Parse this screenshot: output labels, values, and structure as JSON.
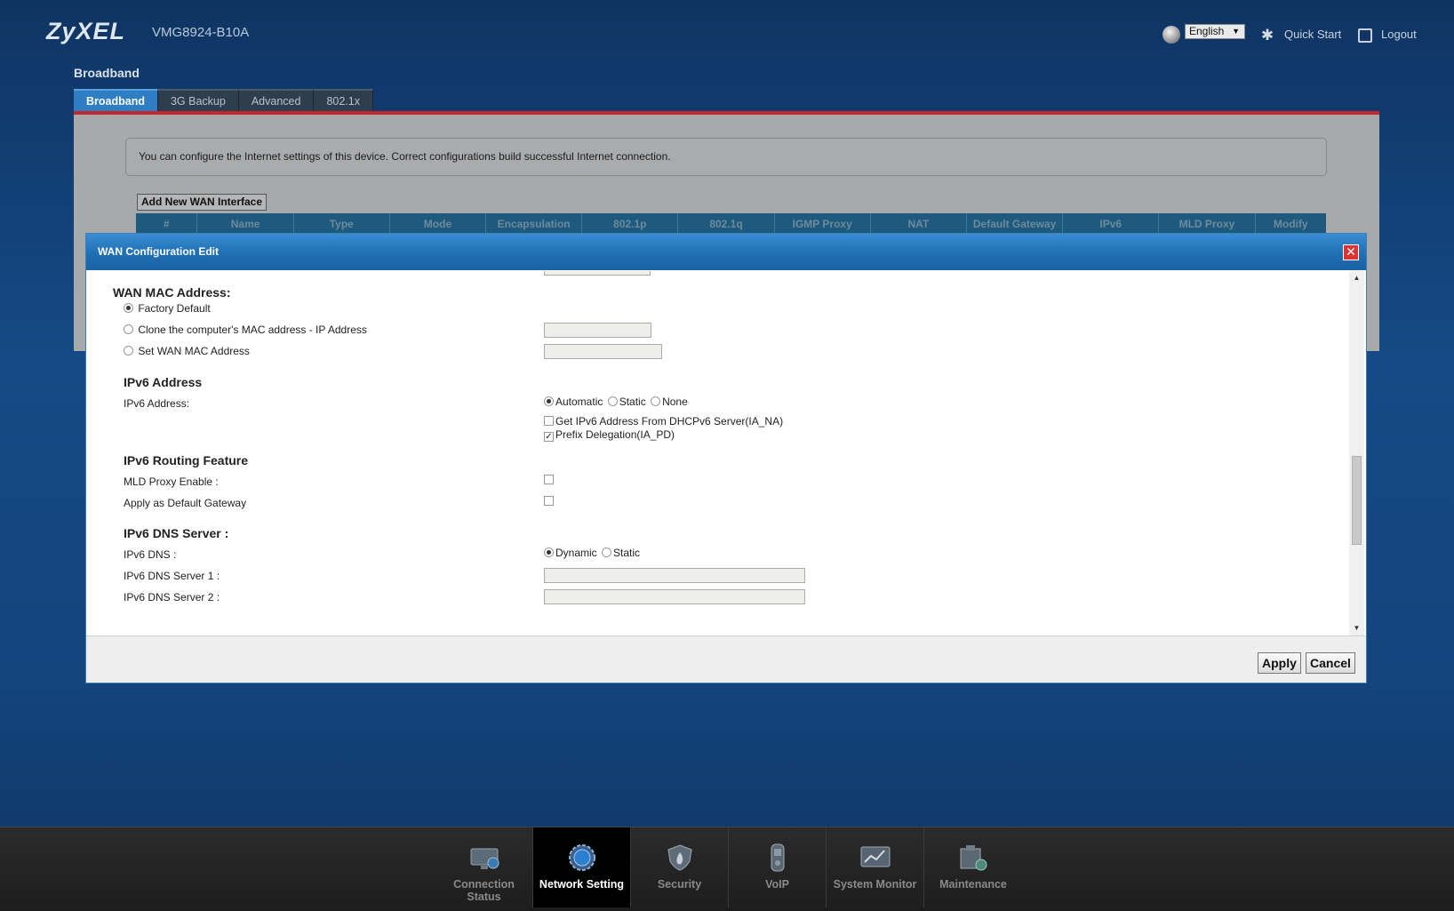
{
  "header": {
    "brand": "ZyXEL",
    "model": "VMG8924-B10A",
    "language": "English",
    "quick_start": "Quick Start",
    "logout": "Logout"
  },
  "page": {
    "title": "Broadband",
    "tabs": [
      {
        "label": "Broadband",
        "active": true
      },
      {
        "label": "3G Backup",
        "active": false
      },
      {
        "label": "Advanced",
        "active": false
      },
      {
        "label": "802.1x",
        "active": false
      }
    ],
    "info": "You can configure the Internet settings of this device. Correct configurations build successful Internet connection.",
    "add_wan": "Add New WAN Interface",
    "columns": [
      "#",
      "Name",
      "Type",
      "Mode",
      "Encapsulation",
      "802.1p",
      "802.1q",
      "IGMP Proxy",
      "NAT",
      "Default Gateway",
      "IPv6",
      "MLD Proxy",
      "Modify"
    ]
  },
  "modal": {
    "title": "WAN Configuration Edit",
    "close": "✕",
    "wan_mac": {
      "heading": "WAN MAC Address:",
      "factory_default": "Factory Default",
      "clone": "Clone the computer's MAC address - IP Address",
      "set": "Set WAN MAC Address"
    },
    "ipv6_address": {
      "heading": "IPv6 Address",
      "label": "IPv6 Address:",
      "automatic": "Automatic",
      "static": "Static",
      "none": "None",
      "get_dhcpv6": "Get IPv6 Address From DHCPv6 Server(IA_NA)",
      "prefix_delegation": "Prefix Delegation(IA_PD)"
    },
    "ipv6_routing": {
      "heading": "IPv6 Routing Feature",
      "mld_proxy": "MLD Proxy Enable :",
      "default_gateway": "Apply as Default Gateway"
    },
    "ipv6_dns": {
      "heading": "IPv6 DNS Server :",
      "dns_label": "IPv6 DNS :",
      "dynamic": "Dynamic",
      "static": "Static",
      "server1": "IPv6 DNS Server 1 :",
      "server2": "IPv6 DNS Server 2 :"
    },
    "apply": "Apply",
    "cancel": "Cancel"
  },
  "bottom_nav": [
    {
      "label": "Connection Status",
      "icon": "monitor-globe-icon",
      "active": false
    },
    {
      "label": "Network Setting",
      "icon": "globe-gear-icon",
      "active": true
    },
    {
      "label": "Security",
      "icon": "shield-flame-icon",
      "active": false
    },
    {
      "label": "VoIP",
      "icon": "phone-icon",
      "active": false
    },
    {
      "label": "System Monitor",
      "icon": "chart-monitor-icon",
      "active": false
    },
    {
      "label": "Maintenance",
      "icon": "toolbox-icon",
      "active": false
    }
  ]
}
